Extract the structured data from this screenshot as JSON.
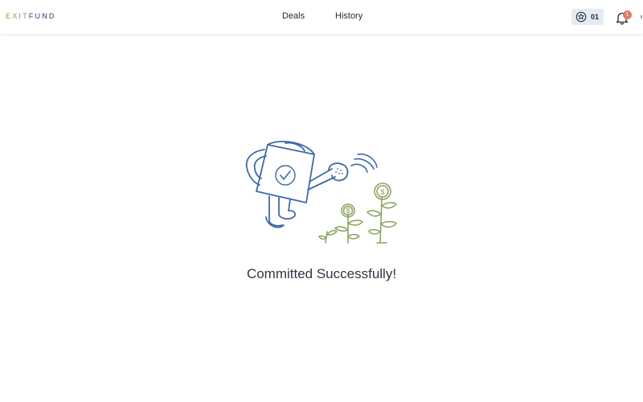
{
  "header": {
    "logo": {
      "part1": "EXIT",
      "part2": "FUND"
    },
    "nav": [
      {
        "label": "Deals"
      },
      {
        "label": "History"
      }
    ],
    "points": {
      "icon": "star-icon",
      "value": "01"
    },
    "notifications": {
      "icon": "bell-icon",
      "count": "1"
    }
  },
  "main": {
    "illustration": "watering-can-money-plants-illustration",
    "message": "Committed Successfully!"
  },
  "colors": {
    "brand_green": "#8a9a3e",
    "brand_navy": "#1f3f6e",
    "illustration_blue": "#3d6aa8",
    "illustration_green": "#8aa05a",
    "notification_badge": "#e07a6a",
    "points_badge_bg": "#e6ebf3"
  }
}
